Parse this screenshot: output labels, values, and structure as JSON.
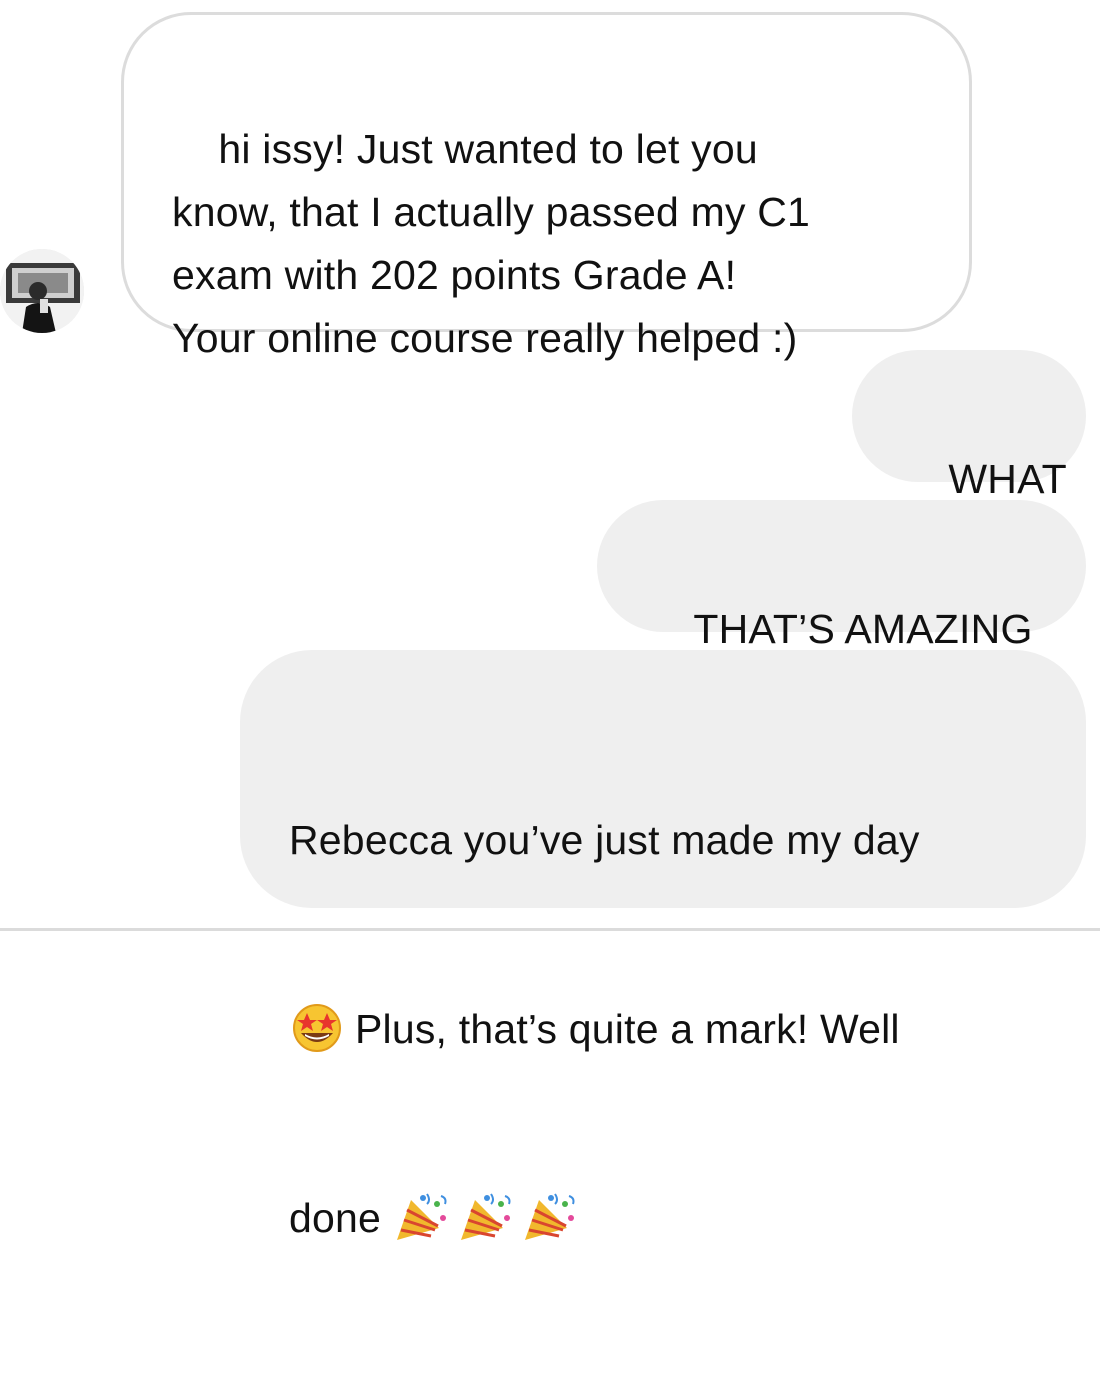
{
  "conversation": {
    "messages": [
      {
        "sender": "contact",
        "text": "hi issy! Just wanted to let you\nknow, that I actually passed my C1\nexam with 202 points Grade A!\nYour online course really helped :)"
      },
      {
        "sender": "me",
        "text": "WHAT"
      },
      {
        "sender": "me",
        "text": "THAT’S AMAZING"
      },
      {
        "sender": "me",
        "line1": "Rebecca you’ve just made my day",
        "line2": "Plus, that’s quite a mark! Well",
        "line3": "done",
        "emojis": [
          "star-struck-emoji",
          "party-popper-emoji",
          "party-popper-emoji",
          "party-popper-emoji"
        ]
      }
    ]
  },
  "colors": {
    "outgoing_bubble": "#efefef",
    "incoming_border": "#dcdcdc",
    "text": "#111111"
  }
}
